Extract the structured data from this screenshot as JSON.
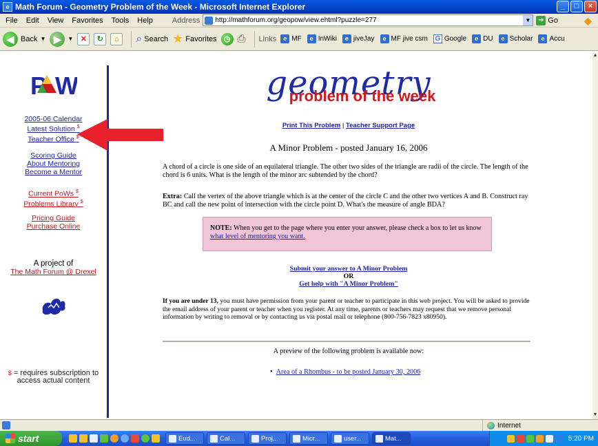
{
  "window": {
    "title": "Math Forum - Geometry Problem of the Week - Microsoft Internet Explorer",
    "min": "_",
    "max": "□",
    "close": "×"
  },
  "menu": [
    "File",
    "Edit",
    "View",
    "Favorites",
    "Tools",
    "Help"
  ],
  "address": {
    "label": "Address",
    "url": "http://mathforum.org/geopow/view.ehtml?puzzle=277",
    "go": "Go"
  },
  "toolbar": {
    "back": "Back",
    "search": "Search",
    "favorites": "Favorites",
    "links_label": "Links",
    "links": [
      "MF",
      "InWiki",
      "jiveJay",
      "MF jive csm",
      "Google",
      "DU",
      "Scholar",
      "Accu"
    ]
  },
  "sidebar": {
    "logo_text": "PoW",
    "group1": [
      {
        "label": "2005-06 Calendar",
        "sup": ""
      },
      {
        "label": "Latest Solution",
        "sup": "$"
      },
      {
        "label": "Teacher Office",
        "sup": "$"
      }
    ],
    "group2": [
      {
        "label": "Scoring Guide",
        "sup": ""
      },
      {
        "label": "About Mentoring",
        "sup": ""
      },
      {
        "label": "Become a Mentor",
        "sup": ""
      }
    ],
    "group3": [
      {
        "label": "Current PoWs",
        "sup": "$"
      },
      {
        "label": "Problems Library",
        "sup": "$"
      }
    ],
    "group4": [
      {
        "label": "Pricing Guide",
        "sup": ""
      },
      {
        "label": "Purchase Online",
        "sup": ""
      }
    ],
    "project_text": "A project of",
    "project_link": "The Math Forum @ Drexel",
    "footnote_symbol": "$",
    "footnote": " = requires subscription to access actual content"
  },
  "main": {
    "banner_geo": "geometry",
    "banner_potw": "problem of the week",
    "print_link": "Print This Problem",
    "print_sep": " | ",
    "support_link": "Teacher Support Page",
    "problem_title": "A Minor Problem - posted January 16, 2006",
    "problem_text": "A chord of a circle is one side of an equilateral triangle. The other two sides of the triangle are radii of the circle. The length of the chord is 6 units. What is the length of the minor arc subtended by the chord?",
    "extra_label": "Extra:",
    "extra_text": " Call the vertex of the above triangle which is at the center of the circle C and the other two vertices A and B. Construct ray BC and call the new point of intersection with the circle point D. What's the measure of angle BDA?",
    "note_label": "NOTE:",
    "note_text": " When you get to the page where you enter your answer, please check a box to let us know ",
    "note_link": "what level of mentoring you want.",
    "submit_link": "Submit your answer to  A Minor Problem",
    "or": "OR",
    "help_link": "Get help with  \"A Minor Problem\"",
    "under13_label": "If you are under 13,",
    "under13_text": " you must have permission from your parent or teacher to participate in this web project. You will be asked to provide the email address of your parent or teacher when you register. At any time, parents or teachers may request that we remove personal information by writing to removal or by contacting us via postal mail or telephone (800-756-7823 x80950).",
    "preview_text": "A preview of the following problem is available now:",
    "preview_link": "Area of a Rhombus - to be posted January 30, 2006"
  },
  "status": {
    "zone": "Internet"
  },
  "taskbar": {
    "start": "start",
    "tasks": [
      "Eud...",
      "Cal...",
      "Proj...",
      "Micr...",
      "user...",
      "Mat..."
    ],
    "clock": "5:20 PM"
  },
  "colors": {
    "sidebar_link": "#1a23a8",
    "sidebar_red_link": "#c4121a",
    "divider": "#1a2a9c",
    "note_bg": "#f0c5d8",
    "arrow": "#e8212a"
  }
}
